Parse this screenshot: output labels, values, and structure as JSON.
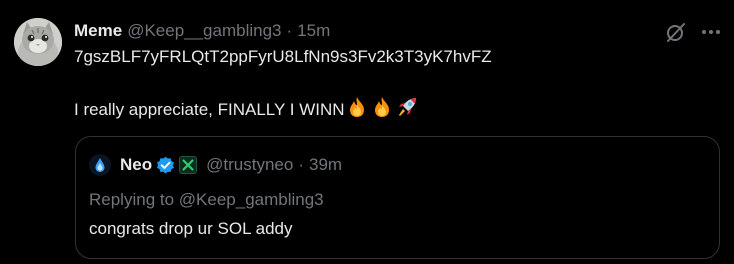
{
  "tweet": {
    "author_name": "Meme",
    "author_handle": "@Keep__gambling3",
    "separator": "·",
    "timestamp": "15m",
    "line1": "7gszBLF7yFRLQtT2ppFyrU8LfNn9s3Fv2k3T3yK7hvFZ",
    "line2": "I really appreciate, FINALLY I WINN",
    "emojis": [
      "fire-emoji",
      "fire-emoji",
      "rocket-emoji"
    ],
    "icons": {
      "grok": "grok-icon",
      "more": "more-icon"
    }
  },
  "quote": {
    "author_name": "Neo",
    "author_handle": "@trustyneo",
    "separator": "·",
    "timestamp": "39m",
    "replying_to": "Replying to @Keep_gambling3",
    "text": "congrats drop ur SOL addy",
    "badges": [
      "verified-badge-icon",
      "affiliate-badge-icon"
    ]
  },
  "colors": {
    "background": "#000000",
    "primary_text": "#e7e9ea",
    "secondary_text": "#71767b",
    "border": "#2f3336",
    "verified_blue": "#1d9bf0",
    "affiliate_green": "#2ecc71"
  }
}
